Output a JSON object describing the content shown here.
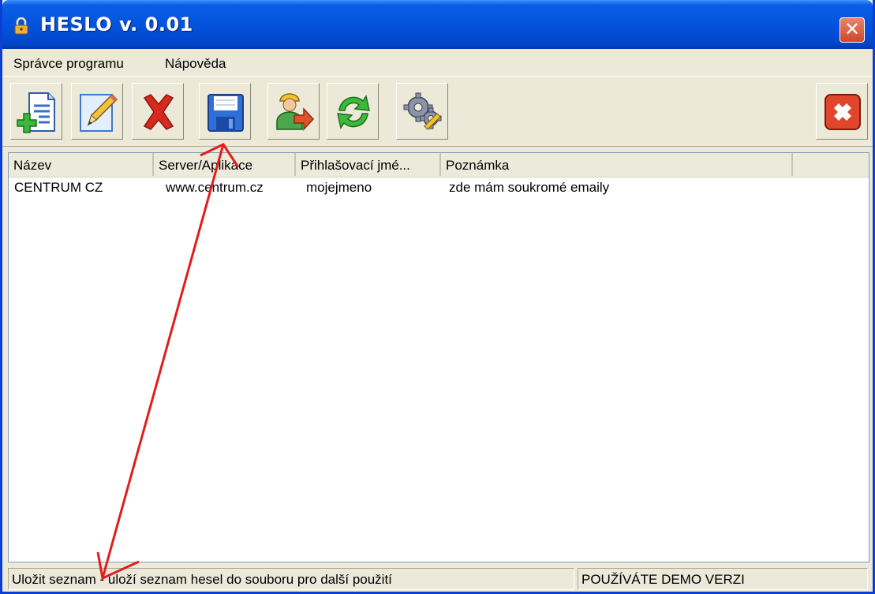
{
  "window": {
    "title": "HESLO v. 0.01",
    "close_glyph": "✕"
  },
  "menu": {
    "items": [
      {
        "label": "Správce programu"
      },
      {
        "label": "Nápověda"
      }
    ]
  },
  "toolbar": {
    "buttons": [
      {
        "icon": "add-document-icon"
      },
      {
        "icon": "edit-pencil-icon"
      },
      {
        "icon": "delete-x-icon"
      },
      {
        "icon": "save-floppy-icon"
      },
      {
        "icon": "user-export-icon"
      },
      {
        "icon": "refresh-arrows-icon"
      },
      {
        "icon": "settings-gears-icon"
      },
      {
        "icon": "exit-close-icon"
      }
    ]
  },
  "list": {
    "columns": [
      "Název",
      "Server/Aplikace",
      "Přihlašovací jmé...",
      "Poznámka"
    ],
    "rows": [
      [
        "CENTRUM CZ",
        "www.centrum.cz",
        "mojejmeno",
        "zde mám soukromé emaily"
      ]
    ]
  },
  "status": {
    "hint": "Uložit seznam - uloží seznam hesel do souboru pro další použití",
    "demo": "POUŽÍVÁTE DEMO VERZI"
  },
  "colors": {
    "title_bar": "#0453dd",
    "annotation_arrow": "#e11d1d"
  }
}
